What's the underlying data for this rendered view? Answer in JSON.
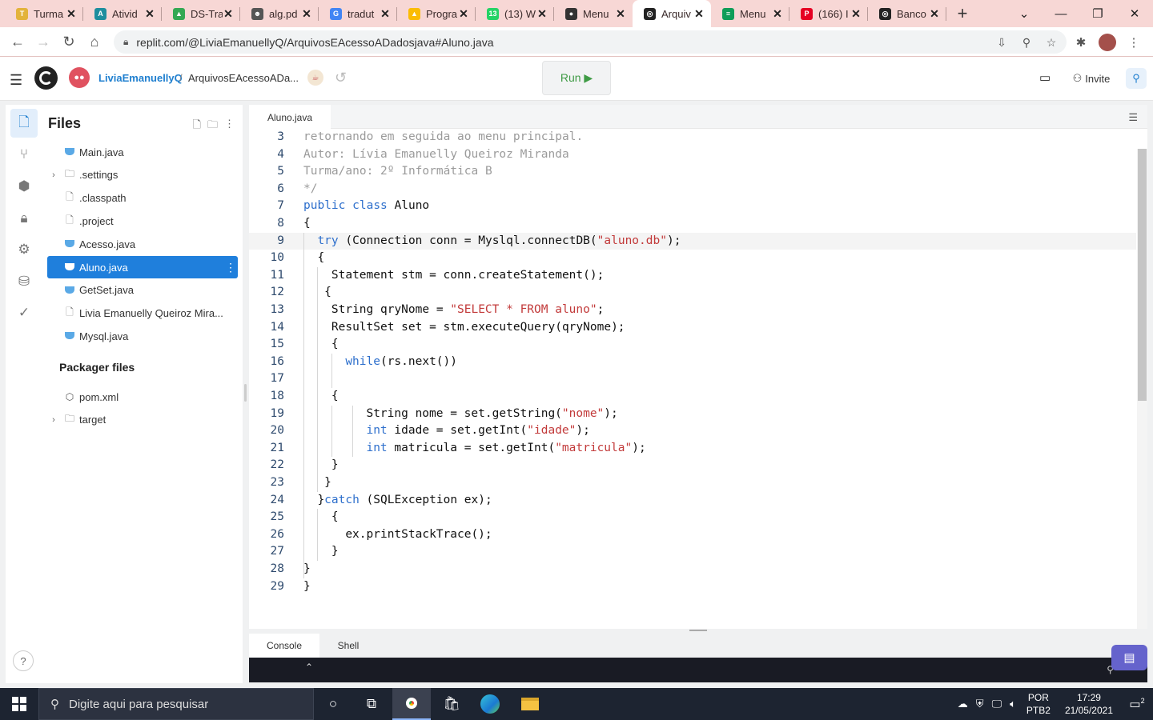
{
  "browser": {
    "tabs": [
      {
        "title": "Turma",
        "color": "#e3b33b",
        "glyph": "T"
      },
      {
        "title": "Ativid",
        "color": "#1e8e9e",
        "glyph": "A"
      },
      {
        "title": "DS-Tra",
        "color": "#34a853",
        "glyph": "▲"
      },
      {
        "title": "alg.pd",
        "color": "#555555",
        "glyph": "☻"
      },
      {
        "title": "tradut",
        "color": "#4285f4",
        "glyph": "G"
      },
      {
        "title": "Progra",
        "color": "#fbbc04",
        "glyph": "▲"
      },
      {
        "title": "(13) W",
        "color": "#25d366",
        "glyph": "13"
      },
      {
        "title": "Menu",
        "color": "#333333",
        "glyph": "●"
      },
      {
        "title": "Arquiv",
        "color": "#222222",
        "glyph": "◎"
      },
      {
        "title": "Menu",
        "color": "#0f9d58",
        "glyph": "≡"
      },
      {
        "title": "(166) I",
        "color": "#e60023",
        "glyph": "P"
      },
      {
        "title": "Banco",
        "color": "#222222",
        "glyph": "◎"
      }
    ],
    "active_tab_index": 8,
    "new_tab_symbol": "+",
    "url": "replit.com/@LiviaEmanuellyQ/ArquivosEAcessoADadosjava#Aluno.java"
  },
  "header": {
    "username": "LiviaEmanuellyQ",
    "separator": "/",
    "repl_name": "ArquivosEAcessoADa...",
    "run_label": "Run ▶",
    "invite_label": "Invite"
  },
  "sidebar": {
    "title": "Files",
    "files": [
      {
        "name": "Main.java",
        "type": "java",
        "folder": false
      },
      {
        "name": ".settings",
        "type": "folder",
        "folder": true
      },
      {
        "name": ".classpath",
        "type": "file",
        "folder": false
      },
      {
        "name": ".project",
        "type": "file",
        "folder": false
      },
      {
        "name": "Acesso.java",
        "type": "java",
        "folder": false
      },
      {
        "name": "Aluno.java",
        "type": "java",
        "folder": false,
        "selected": true
      },
      {
        "name": "GetSet.java",
        "type": "java",
        "folder": false
      },
      {
        "name": "Livia Emanuelly Queiroz Mira...",
        "type": "file",
        "folder": false
      },
      {
        "name": "Mysql.java",
        "type": "java",
        "folder": false
      }
    ],
    "packager_title": "Packager files",
    "packager_files": [
      {
        "name": "pom.xml",
        "type": "package",
        "folder": false
      },
      {
        "name": "target",
        "type": "folder",
        "folder": true
      }
    ]
  },
  "editor": {
    "tab_title": "Aluno.java",
    "highlight_line": 9,
    "lines": [
      {
        "n": "3",
        "indent": 0,
        "guides": 0,
        "tokens": [
          [
            "c",
            "retornando em seguida ao menu principal."
          ]
        ]
      },
      {
        "n": "4",
        "indent": 0,
        "guides": 0,
        "tokens": [
          [
            "c",
            "Autor: Lívia Emanuelly Queiroz Miranda"
          ]
        ]
      },
      {
        "n": "5",
        "indent": 0,
        "guides": 0,
        "tokens": [
          [
            "c",
            "Turma/ano: 2º Informática B"
          ]
        ]
      },
      {
        "n": "6",
        "indent": 0,
        "guides": 0,
        "tokens": [
          [
            "c",
            "*/"
          ]
        ]
      },
      {
        "n": "7",
        "indent": 0,
        "guides": 0,
        "tokens": [
          [
            "k",
            "public"
          ],
          [
            "t",
            " "
          ],
          [
            "k",
            "class"
          ],
          [
            "t",
            " Aluno"
          ]
        ]
      },
      {
        "n": "8",
        "indent": 0,
        "guides": 0,
        "tokens": [
          [
            "t",
            "{"
          ]
        ]
      },
      {
        "n": "9",
        "indent": 2,
        "guides": 1,
        "tokens": [
          [
            "k",
            "try"
          ],
          [
            "t",
            " (Connection conn = Myslql.connectDB("
          ],
          [
            "s",
            "\"aluno.db\""
          ],
          [
            "t",
            ");"
          ]
        ]
      },
      {
        "n": "10",
        "indent": 2,
        "guides": 1,
        "tokens": [
          [
            "t",
            "{"
          ]
        ]
      },
      {
        "n": "11",
        "indent": 4,
        "guides": 2,
        "tokens": [
          [
            "t",
            "Statement stm = conn.createStatement();"
          ]
        ]
      },
      {
        "n": "12",
        "indent": 3,
        "guides": 2,
        "tokens": [
          [
            "t",
            "{"
          ]
        ]
      },
      {
        "n": "13",
        "indent": 4,
        "guides": 2,
        "tokens": [
          [
            "t",
            "String qryNome = "
          ],
          [
            "s",
            "\"SELECT * FROM aluno\""
          ],
          [
            "t",
            ";"
          ]
        ]
      },
      {
        "n": "14",
        "indent": 4,
        "guides": 2,
        "tokens": [
          [
            "t",
            "ResultSet set = stm.executeQuery(qryNome);"
          ]
        ]
      },
      {
        "n": "15",
        "indent": 4,
        "guides": 2,
        "tokens": [
          [
            "t",
            "{"
          ]
        ]
      },
      {
        "n": "16",
        "indent": 6,
        "guides": 3,
        "tokens": [
          [
            "k",
            "while"
          ],
          [
            "t",
            "(rs.next())"
          ]
        ]
      },
      {
        "n": "17",
        "indent": 0,
        "guides": 3,
        "tokens": []
      },
      {
        "n": "18",
        "indent": 4,
        "guides": 2,
        "tokens": [
          [
            "t",
            "{"
          ]
        ]
      },
      {
        "n": "19",
        "indent": 9,
        "guides": 4,
        "tokens": [
          [
            "t",
            "String nome = set.getString("
          ],
          [
            "s",
            "\"nome\""
          ],
          [
            "t",
            ");"
          ]
        ]
      },
      {
        "n": "20",
        "indent": 9,
        "guides": 4,
        "tokens": [
          [
            "k",
            "int"
          ],
          [
            "t",
            " idade = set.getInt("
          ],
          [
            "s",
            "\"idade\""
          ],
          [
            "t",
            ");"
          ]
        ]
      },
      {
        "n": "21",
        "indent": 9,
        "guides": 4,
        "tokens": [
          [
            "k",
            "int"
          ],
          [
            "t",
            " matricula = set.getInt("
          ],
          [
            "s",
            "\"matricula\""
          ],
          [
            "t",
            ");"
          ]
        ]
      },
      {
        "n": "22",
        "indent": 4,
        "guides": 2,
        "tokens": [
          [
            "t",
            "}"
          ]
        ]
      },
      {
        "n": "23",
        "indent": 3,
        "guides": 2,
        "tokens": [
          [
            "t",
            "}"
          ]
        ]
      },
      {
        "n": "24",
        "indent": 2,
        "guides": 1,
        "tokens": [
          [
            "t",
            "}"
          ],
          [
            "k",
            "catch"
          ],
          [
            "t",
            " (SQLException ex);"
          ]
        ]
      },
      {
        "n": "25",
        "indent": 4,
        "guides": 2,
        "tokens": [
          [
            "t",
            "{"
          ]
        ]
      },
      {
        "n": "26",
        "indent": 6,
        "guides": 2,
        "tokens": [
          [
            "t",
            "ex.printStackTrace();"
          ]
        ]
      },
      {
        "n": "27",
        "indent": 4,
        "guides": 2,
        "tokens": [
          [
            "t",
            "}"
          ]
        ]
      },
      {
        "n": "28",
        "indent": 0,
        "guides": 1,
        "tokens": [
          [
            "t",
            "}"
          ]
        ]
      },
      {
        "n": "29",
        "indent": 0,
        "guides": 0,
        "tokens": [
          [
            "t",
            "}"
          ]
        ]
      }
    ]
  },
  "console": {
    "tabs": [
      "Console",
      "Shell"
    ],
    "active_tab": "Console",
    "caret_symbol": "⌃"
  },
  "taskbar": {
    "search_placeholder": "Digite aqui para pesquisar",
    "language_top": "POR",
    "language_bottom": "PTB2",
    "time": "17:29",
    "date": "21/05/2021",
    "notification_count": "2"
  },
  "colors": {
    "accent": "#1f7fdc",
    "keyword": "#2d6fcc",
    "string": "#c23a3a",
    "comment": "#9b9b9b",
    "run": "#3f9b45"
  }
}
